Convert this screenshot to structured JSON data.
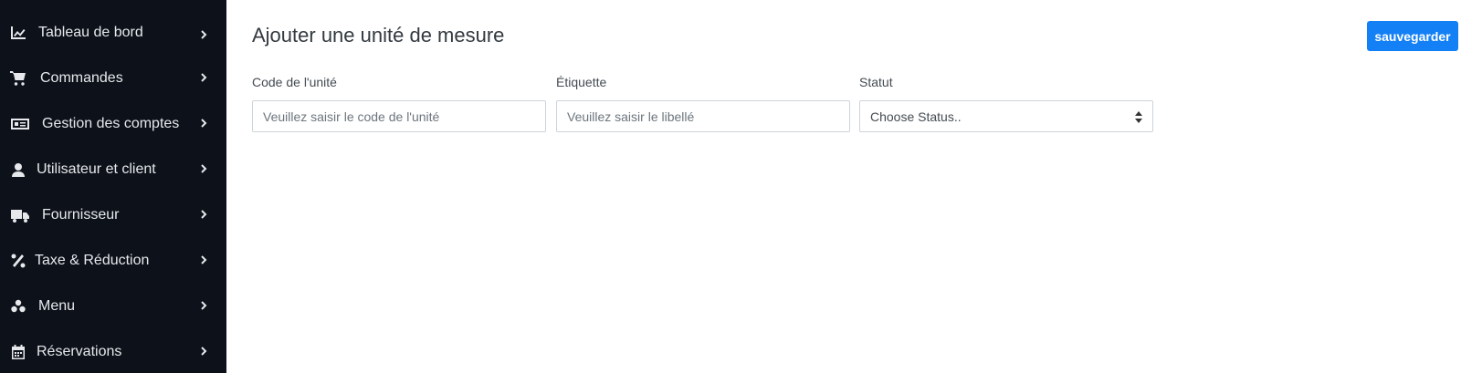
{
  "sidebar": {
    "items": [
      {
        "label": "Tableau de bord",
        "icon": "chart-line-icon"
      },
      {
        "label": "Commandes",
        "icon": "cart-icon"
      },
      {
        "label": "Gestion des comptes",
        "icon": "money-card-icon"
      },
      {
        "label": "Utilisateur et client",
        "icon": "user-icon"
      },
      {
        "label": "Fournisseur",
        "icon": "truck-icon"
      },
      {
        "label": "Taxe & Réduction",
        "icon": "percent-icon"
      },
      {
        "label": "Menu",
        "icon": "menu-icon"
      },
      {
        "label": "Réservations",
        "icon": "calendar-icon"
      }
    ]
  },
  "main": {
    "title": "Ajouter une unité de mesure",
    "save_label": "sauvegarder",
    "fields": {
      "code": {
        "label": "Code de l'unité",
        "placeholder": "Veuillez saisir le code de l'unité",
        "value": ""
      },
      "label": {
        "label": "Étiquette",
        "placeholder": "Veuillez saisir le libellé",
        "value": ""
      },
      "status": {
        "label": "Statut",
        "selected": "Choose Status.."
      }
    }
  },
  "colors": {
    "sidebar_bg": "#0c111a",
    "accent": "#1480f5"
  }
}
